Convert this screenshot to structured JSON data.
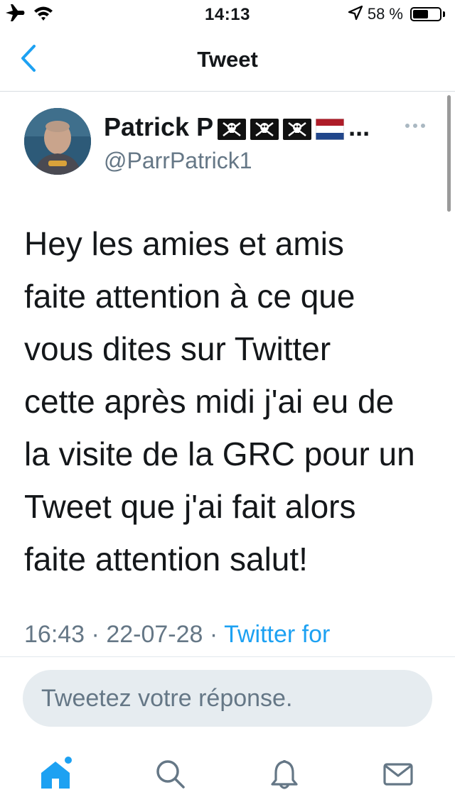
{
  "status_bar": {
    "time": "14:13",
    "battery": "58 %",
    "battery_level": 0.58,
    "icons": [
      "airplane-icon",
      "wifi-icon",
      "location-arrow-icon",
      "battery-icon"
    ]
  },
  "nav": {
    "title": "Tweet",
    "back_icon": "chevron-left-icon"
  },
  "tweet": {
    "display_name": "Patrick P",
    "name_suffix": "...",
    "name_emojis": [
      "pirate-flag",
      "pirate-flag",
      "pirate-flag",
      "netherlands-flag"
    ],
    "handle": "@ParrPatrick1",
    "text": "Hey les amies et amis\nfaite attention à ce que\nvous dites sur Twitter\ncette après midi j'ai eu de\nla visite de la GRC pour un\nTweet que j'ai fait alors\nfaite attention salut!",
    "time": "16:43",
    "separator": "·",
    "date": "22-07-28",
    "source": "Twitter for"
  },
  "reply": {
    "placeholder": "Tweetez votre réponse."
  },
  "tab_bar": {
    "tabs": [
      "home-icon",
      "search-icon",
      "notifications-icon",
      "messages-icon"
    ]
  },
  "colors": {
    "accent": "#1da1f2",
    "secondary_text": "#657786",
    "input_bg": "#e6ecf0"
  }
}
